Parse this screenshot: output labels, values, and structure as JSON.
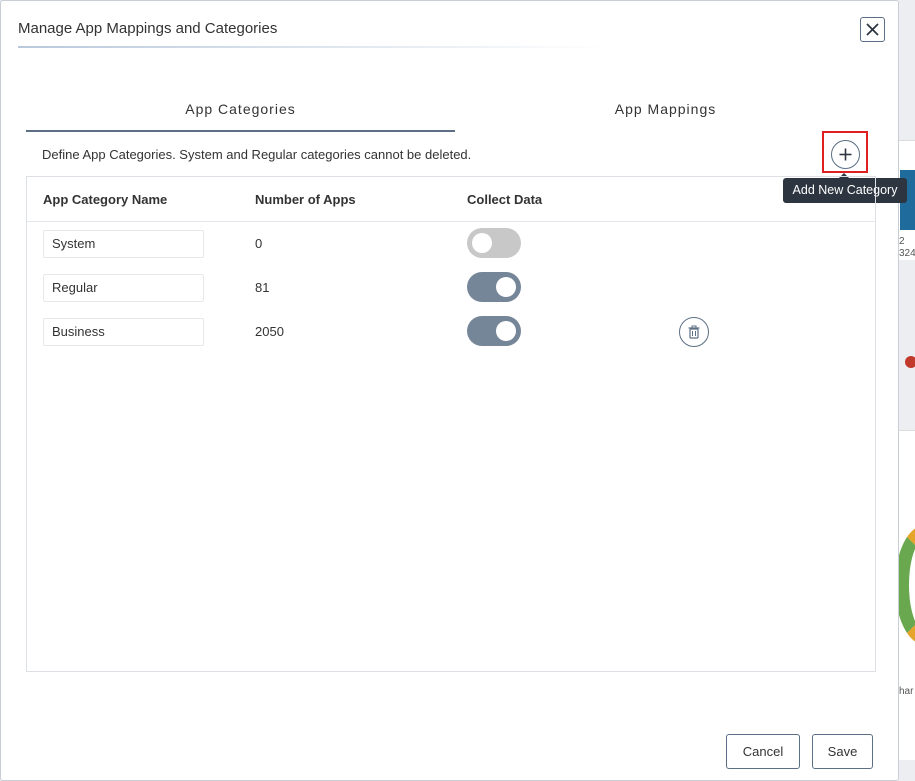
{
  "modal": {
    "title": "Manage App Mappings and Categories"
  },
  "tabs": [
    {
      "label": "App Categories",
      "active": true
    },
    {
      "label": "App Mappings",
      "active": false
    }
  ],
  "description": "Define App Categories. System and Regular categories cannot be deleted.",
  "add_button": {
    "icon": "plus-icon",
    "tooltip": "Add New Category"
  },
  "table": {
    "headers": [
      "App Category Name",
      "Number of Apps",
      "Collect Data"
    ],
    "rows": [
      {
        "name": "System",
        "apps": "0",
        "collect": false,
        "deletable": false
      },
      {
        "name": "Regular",
        "apps": "81",
        "collect": true,
        "deletable": false
      },
      {
        "name": "Business",
        "apps": "2050",
        "collect": true,
        "deletable": true
      }
    ]
  },
  "footer": {
    "cancel_label": "Cancel",
    "save_label": "Save"
  },
  "background": {
    "text1": "2",
    "text2": "324",
    "text3": "har"
  },
  "colors": {
    "accent": "#5d6f85",
    "toggle_on": "#768699",
    "toggle_off": "#c8c8c8",
    "highlight": "#e02020",
    "tooltip_bg": "#2d3540"
  }
}
